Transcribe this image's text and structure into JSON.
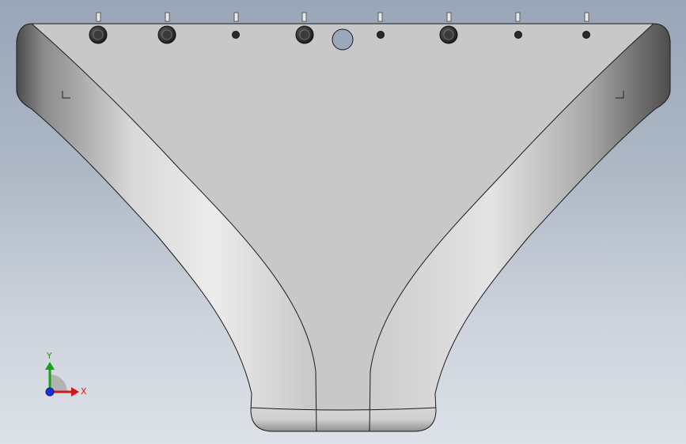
{
  "viewport": {
    "background_top": "#99a6b8",
    "background_bottom": "#dde1e8",
    "part": {
      "face_color": "#c8c8c8",
      "edge_color": "#1a1a1a",
      "fastener_count": 8,
      "center_hole": true
    }
  },
  "triad": {
    "x_label": "X",
    "y_label": "Y",
    "x_color": "#d01818",
    "y_color": "#18a018",
    "z_color": "#1830d0"
  }
}
